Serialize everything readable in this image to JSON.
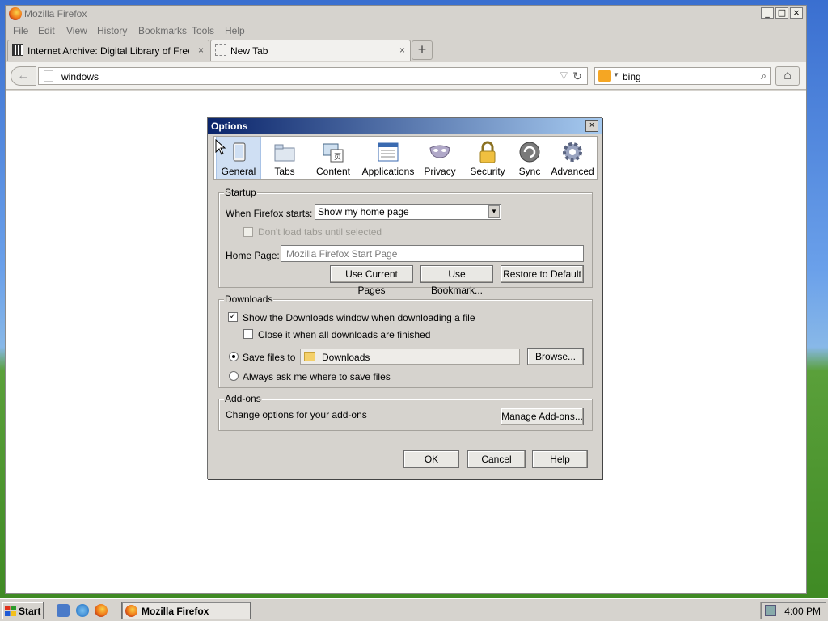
{
  "window": {
    "title": "Mozilla Firefox",
    "controls": [
      "_",
      "□",
      "×"
    ]
  },
  "menu": [
    "File",
    "Edit",
    "View",
    "History",
    "Bookmarks",
    "Tools",
    "Help"
  ],
  "tabs": [
    {
      "title": "Internet Archive: Digital Library of Free ...",
      "close": "×"
    },
    {
      "title": "New Tab",
      "close": "×"
    }
  ],
  "newtab_label": "+",
  "navbar": {
    "back_glyph": "←",
    "url": "windows",
    "star_glyph": "▽",
    "reload_glyph": "↻",
    "search_text": "bing",
    "search_engine_icon": "bing-icon",
    "search_glyph": "⌕",
    "home_glyph": "⌂"
  },
  "dialog": {
    "title": "Options",
    "close": "×",
    "panes": [
      {
        "label": "General",
        "icon": "general-icon"
      },
      {
        "label": "Tabs",
        "icon": "tabs-icon"
      },
      {
        "label": "Content",
        "icon": "content-icon"
      },
      {
        "label": "Applications",
        "icon": "applications-icon"
      },
      {
        "label": "Privacy",
        "icon": "privacy-icon"
      },
      {
        "label": "Security",
        "icon": "security-icon"
      },
      {
        "label": "Sync",
        "icon": "sync-icon"
      },
      {
        "label": "Advanced",
        "icon": "advanced-icon"
      }
    ],
    "selected_pane": "General",
    "startup": {
      "legend": "Startup",
      "when_starts_label": "When Firefox starts:",
      "when_starts_value": "Show my home page",
      "dont_load_label": "Don't load tabs until selected",
      "dont_load_checked": false,
      "home_page_label": "Home Page:",
      "home_page_placeholder": "Mozilla Firefox Start Page",
      "use_current_pages": "Use Current Pages",
      "use_bookmark": "Use Bookmark...",
      "restore_default": "Restore to Default"
    },
    "downloads": {
      "legend": "Downloads",
      "show_window_label": "Show the Downloads window when downloading a file",
      "show_window_checked": true,
      "close_when_done_label": "Close it when all downloads are finished",
      "close_when_done_checked": false,
      "save_files_label": "Save files to",
      "save_folder": "Downloads",
      "browse": "Browse...",
      "always_ask_label": "Always ask me where to save files",
      "selected_option": "save_files_to"
    },
    "addons": {
      "legend": "Add-ons",
      "description": "Change options for your add-ons",
      "manage": "Manage Add-ons..."
    },
    "buttons": {
      "ok": "OK",
      "cancel": "Cancel",
      "help": "Help"
    }
  },
  "taskbar": {
    "start": "Start",
    "task_label": "Mozilla Firefox",
    "clock": "4:00 PM"
  }
}
